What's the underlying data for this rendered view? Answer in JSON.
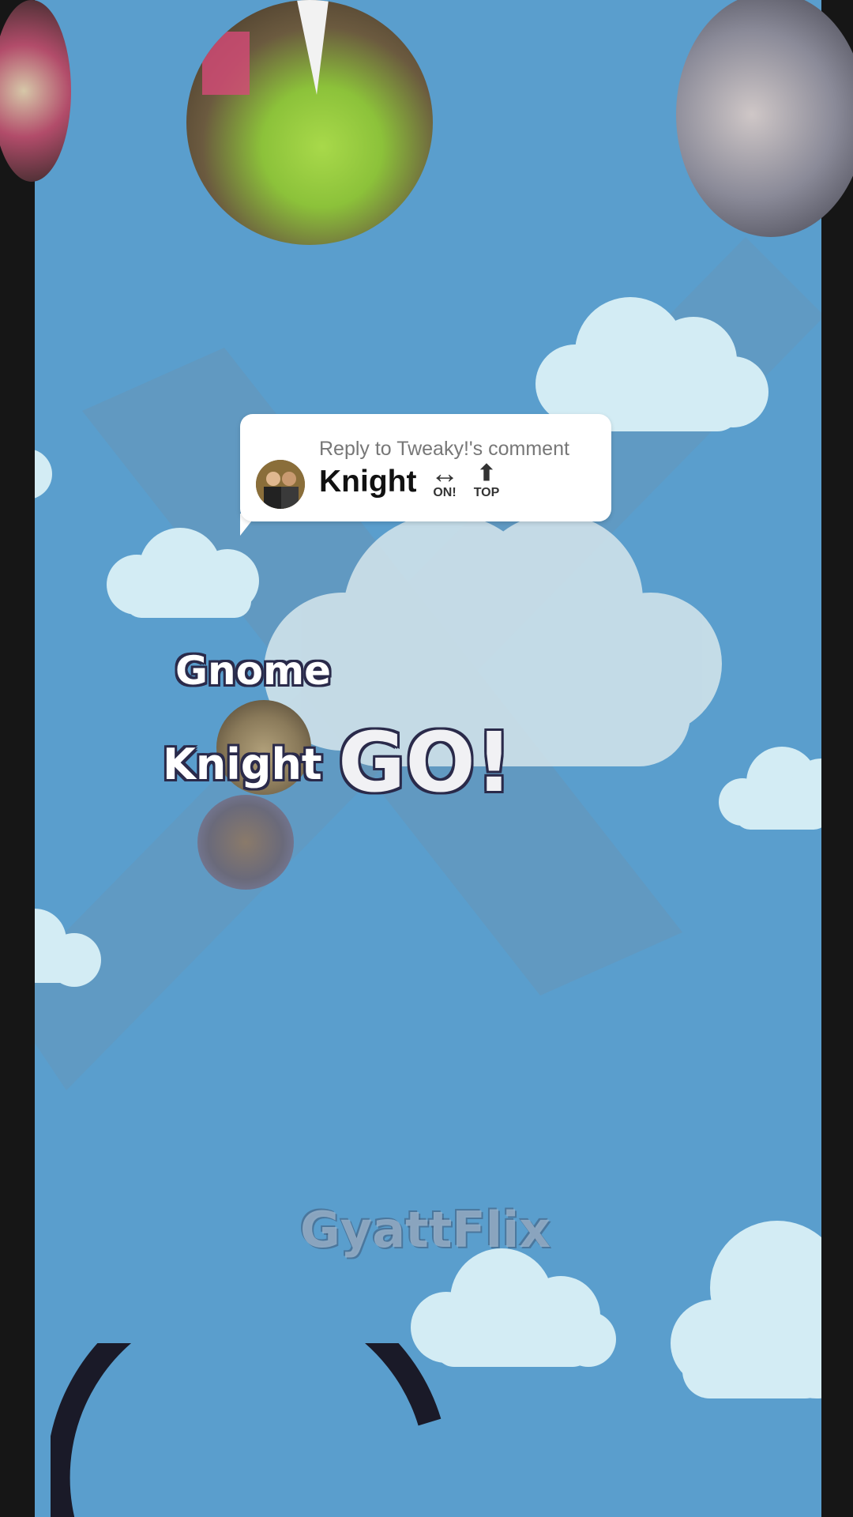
{
  "reply": {
    "label": "Reply to Tweaky!'s comment",
    "name": "Knight",
    "icon_on": {
      "glyph": "↔",
      "caption": "ON!"
    },
    "icon_top": {
      "glyph": "⬆",
      "caption": "TOP"
    }
  },
  "title": {
    "line1": "Gnome",
    "line2": "Knight",
    "go": "GO!"
  },
  "watermark": "GyattFlix",
  "colors": {
    "sky": "#5a9ecd",
    "cloud": "#d3ecf4",
    "bars": "#161616"
  }
}
